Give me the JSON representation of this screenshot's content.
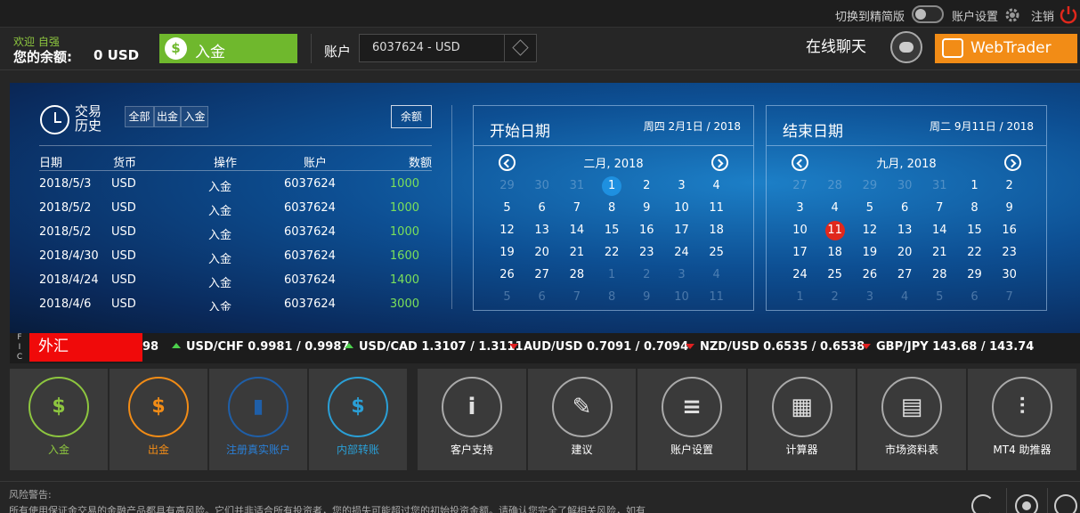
{
  "topbar": {
    "switch_label": "切换到精简版",
    "settings_label": "账户设置",
    "logout_label": "注销"
  },
  "header": {
    "welcome": "欢迎 自强",
    "balance_label": "您的余额:",
    "balance_value": "0 USD",
    "deposit_label": "入金",
    "account_label": "账户",
    "account_value": "6037624 - USD",
    "chat_label": "在线聊天",
    "webtrader_label": "WebTrader"
  },
  "history": {
    "title": "交易历史",
    "filters": [
      "全部",
      "出金",
      "入金"
    ],
    "balance_button": "余额",
    "columns": [
      "日期",
      "货币",
      "操作",
      "账户",
      "数额"
    ],
    "rows": [
      [
        "2018/5/3",
        "USD",
        "入金",
        "6037624",
        "1000"
      ],
      [
        "2018/5/2",
        "USD",
        "入金",
        "6037624",
        "1000"
      ],
      [
        "2018/5/2",
        "USD",
        "入金",
        "6037624",
        "1000"
      ],
      [
        "2018/4/30",
        "USD",
        "入金",
        "6037624",
        "1600"
      ],
      [
        "2018/4/24",
        "USD",
        "入金",
        "6037624",
        "1400"
      ],
      [
        "2018/4/6",
        "USD",
        "入金",
        "6037624",
        "3000"
      ]
    ]
  },
  "start_calendar": {
    "title": "开始日期",
    "date_prefix": "周四 2月1日",
    "date_year": " / 2018",
    "month": "二月, 2018",
    "selected_color": "#1e90e0",
    "days": [
      [
        "29",
        "d"
      ],
      [
        "30",
        "d"
      ],
      [
        "31",
        "d"
      ],
      [
        "1",
        "s"
      ],
      [
        "2",
        ""
      ],
      [
        "3",
        ""
      ],
      [
        "4",
        ""
      ],
      [
        "5",
        ""
      ],
      [
        "6",
        ""
      ],
      [
        "7",
        ""
      ],
      [
        "8",
        ""
      ],
      [
        "9",
        ""
      ],
      [
        "10",
        ""
      ],
      [
        "11",
        ""
      ],
      [
        "12",
        ""
      ],
      [
        "13",
        ""
      ],
      [
        "14",
        ""
      ],
      [
        "15",
        ""
      ],
      [
        "16",
        ""
      ],
      [
        "17",
        ""
      ],
      [
        "18",
        ""
      ],
      [
        "19",
        ""
      ],
      [
        "20",
        ""
      ],
      [
        "21",
        ""
      ],
      [
        "22",
        ""
      ],
      [
        "23",
        ""
      ],
      [
        "24",
        ""
      ],
      [
        "25",
        ""
      ],
      [
        "26",
        ""
      ],
      [
        "27",
        ""
      ],
      [
        "28",
        ""
      ],
      [
        "1",
        "d"
      ],
      [
        "2",
        "d"
      ],
      [
        "3",
        "d"
      ],
      [
        "4",
        "d"
      ],
      [
        "5",
        "d"
      ],
      [
        "6",
        "d"
      ],
      [
        "7",
        "d"
      ],
      [
        "8",
        "d"
      ],
      [
        "9",
        "d"
      ],
      [
        "10",
        "d"
      ],
      [
        "11",
        "d"
      ]
    ]
  },
  "end_calendar": {
    "title": "结束日期",
    "date_prefix": "周二 9月11日",
    "date_year": " / 2018",
    "month": "九月, 2018",
    "selected_color": "#e0281c",
    "days": [
      [
        "27",
        "d"
      ],
      [
        "28",
        "d"
      ],
      [
        "29",
        "d"
      ],
      [
        "30",
        "d"
      ],
      [
        "31",
        "d"
      ],
      [
        "1",
        ""
      ],
      [
        "2",
        ""
      ],
      [
        "3",
        ""
      ],
      [
        "4",
        ""
      ],
      [
        "5",
        ""
      ],
      [
        "6",
        ""
      ],
      [
        "7",
        ""
      ],
      [
        "8",
        ""
      ],
      [
        "9",
        ""
      ],
      [
        "10",
        ""
      ],
      [
        "11",
        "s"
      ],
      [
        "12",
        ""
      ],
      [
        "13",
        ""
      ],
      [
        "14",
        ""
      ],
      [
        "15",
        ""
      ],
      [
        "16",
        ""
      ],
      [
        "17",
        ""
      ],
      [
        "18",
        ""
      ],
      [
        "19",
        ""
      ],
      [
        "20",
        ""
      ],
      [
        "21",
        ""
      ],
      [
        "22",
        ""
      ],
      [
        "23",
        ""
      ],
      [
        "24",
        ""
      ],
      [
        "25",
        ""
      ],
      [
        "26",
        ""
      ],
      [
        "27",
        ""
      ],
      [
        "28",
        ""
      ],
      [
        "29",
        ""
      ],
      [
        "30",
        ""
      ],
      [
        "1",
        "d"
      ],
      [
        "2",
        "d"
      ],
      [
        "3",
        "d"
      ],
      [
        "4",
        "d"
      ],
      [
        "5",
        "d"
      ],
      [
        "6",
        "d"
      ],
      [
        "7",
        "d"
      ]
    ]
  },
  "ticker": {
    "fic": [
      "F",
      "I",
      "C"
    ],
    "tag": "外汇",
    "partial": "98",
    "quotes": [
      {
        "text": "USD/CHF 0.9981 / 0.9987",
        "dir": "up"
      },
      {
        "text": "USD/CAD 1.3107 / 1.3111",
        "dir": "up"
      },
      {
        "text": "AUD/USD 0.7091 / 0.7094",
        "dir": "down"
      },
      {
        "text": "NZD/USD 0.6535 / 0.6538",
        "dir": "down"
      },
      {
        "text": "GBP/JPY 143.68 / 143.74",
        "dir": "down"
      }
    ]
  },
  "tiles": [
    {
      "label": "入金",
      "color": "#8dc63f",
      "icon": "deposit-icon"
    },
    {
      "label": "出金",
      "color": "#f28c16",
      "icon": "withdraw-icon"
    },
    {
      "label": "注册真实账户",
      "color": "#1f5fa8",
      "icon": "chart-icon"
    },
    {
      "label": "内部转账",
      "color": "#2a9fd6",
      "icon": "transfer-icon"
    },
    {
      "label": "客户支持",
      "color": "#aaaaaa",
      "icon": "info-icon"
    },
    {
      "label": "建议",
      "color": "#aaaaaa",
      "icon": "note-icon"
    },
    {
      "label": "账户设置",
      "color": "#aaaaaa",
      "icon": "sliders-icon"
    },
    {
      "label": "计算器",
      "color": "#aaaaaa",
      "icon": "calculator-icon"
    },
    {
      "label": "市场资料表",
      "color": "#aaaaaa",
      "icon": "report-icon"
    },
    {
      "label": "MT4 助推器",
      "color": "#aaaaaa",
      "icon": "candles-icon"
    }
  ],
  "footer": {
    "risk_label": "风险警告:",
    "risk_text": "所有使用保证金交易的金融产品都具有高风险。它们并非适合所有投资者，您的损失可能超过您的初始投资金额。请确认您完全了解相关风险，如有"
  }
}
